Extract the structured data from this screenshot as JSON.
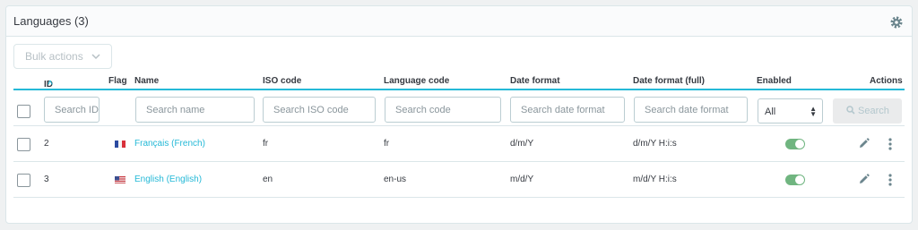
{
  "panel": {
    "title": "Languages (3)"
  },
  "toolbar": {
    "bulk_actions": "Bulk actions"
  },
  "columns": {
    "id": "ID",
    "flag": "Flag",
    "name": "Name",
    "iso": "ISO code",
    "language_code": "Language code",
    "date_format": "Date format",
    "date_format_full": "Date format (full)",
    "enabled": "Enabled",
    "actions": "Actions"
  },
  "filters": {
    "id_placeholder": "Search ID",
    "name_placeholder": "Search name",
    "iso_placeholder": "Search ISO code",
    "code_placeholder": "Search code",
    "date_placeholder": "Search date format",
    "date_full_placeholder": "Search date format",
    "enabled_value": "All",
    "search_button": "Search"
  },
  "rows": [
    {
      "id": "2",
      "flag": "flag-fr-icon",
      "name": "Français (French)",
      "iso": "fr",
      "language_code": "fr",
      "date_format": "d/m/Y",
      "date_format_full": "d/m/Y H:i:s",
      "enabled": true
    },
    {
      "id": "3",
      "flag": "flag-us-icon",
      "name": "English (English)",
      "iso": "en",
      "language_code": "en-us",
      "date_format": "m/d/Y",
      "date_format_full": "m/d/Y H:i:s",
      "enabled": true
    }
  ],
  "colors": {
    "accent": "#25b9d7",
    "enabled": "#70b580"
  }
}
